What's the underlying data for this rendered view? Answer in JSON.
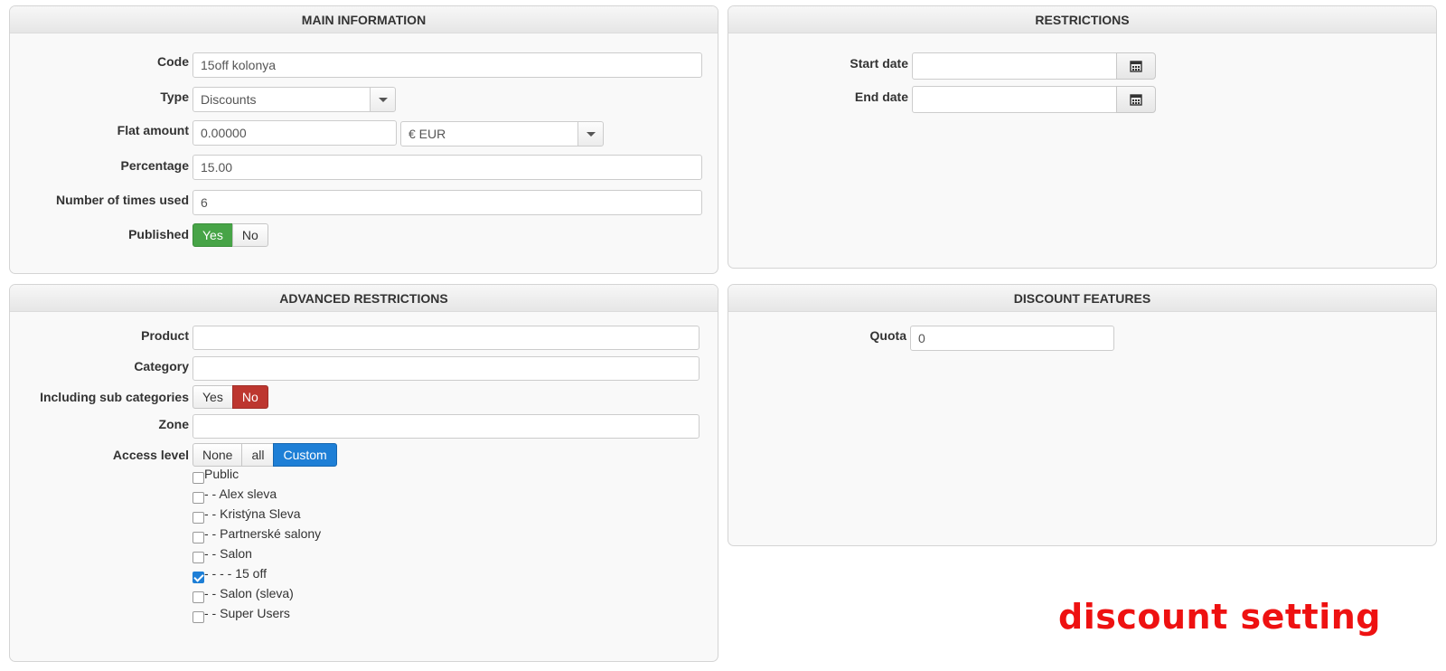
{
  "main_info": {
    "title": "MAIN INFORMATION",
    "code_label": "Code",
    "code_value": "15off kolonya",
    "type_label": "Type",
    "type_value": "Discounts",
    "flat_label": "Flat amount",
    "flat_value": "0.00000",
    "currency_value": "€ EUR",
    "percentage_label": "Percentage",
    "percentage_value": "15.00",
    "times_used_label": "Number of times used",
    "times_used_value": "6",
    "published_label": "Published",
    "yes": "Yes",
    "no": "No"
  },
  "restrictions": {
    "title": "RESTRICTIONS",
    "start_label": "Start date",
    "start_value": "",
    "end_label": "End date",
    "end_value": ""
  },
  "advanced": {
    "title": "ADVANCED RESTRICTIONS",
    "product_label": "Product",
    "category_label": "Category",
    "subcat_label": "Including sub categories",
    "yes": "Yes",
    "no": "No",
    "zone_label": "Zone",
    "access_label": "Access level",
    "access_none": "None",
    "access_all": "all",
    "access_custom": "Custom",
    "groups": [
      {
        "label": "Public",
        "checked": false
      },
      {
        "label": "- - Alex sleva",
        "checked": false
      },
      {
        "label": "- - Kristýna Sleva",
        "checked": false
      },
      {
        "label": "- - Partnerské salony",
        "checked": false
      },
      {
        "label": "- - Salon",
        "checked": false
      },
      {
        "label": "- - - - 15 off",
        "checked": true
      },
      {
        "label": "- - Salon (sleva)",
        "checked": false
      },
      {
        "label": "- - Super Users",
        "checked": false
      }
    ]
  },
  "features": {
    "title": "DISCOUNT FEATURES",
    "quota_label": "Quota",
    "quota_value": "0"
  },
  "watermark": "discount setting",
  "colors": {
    "yes_active": "#47a447",
    "no_active": "#bd362f",
    "custom_active": "#1e7fd6",
    "watermark": "#ee1111"
  }
}
